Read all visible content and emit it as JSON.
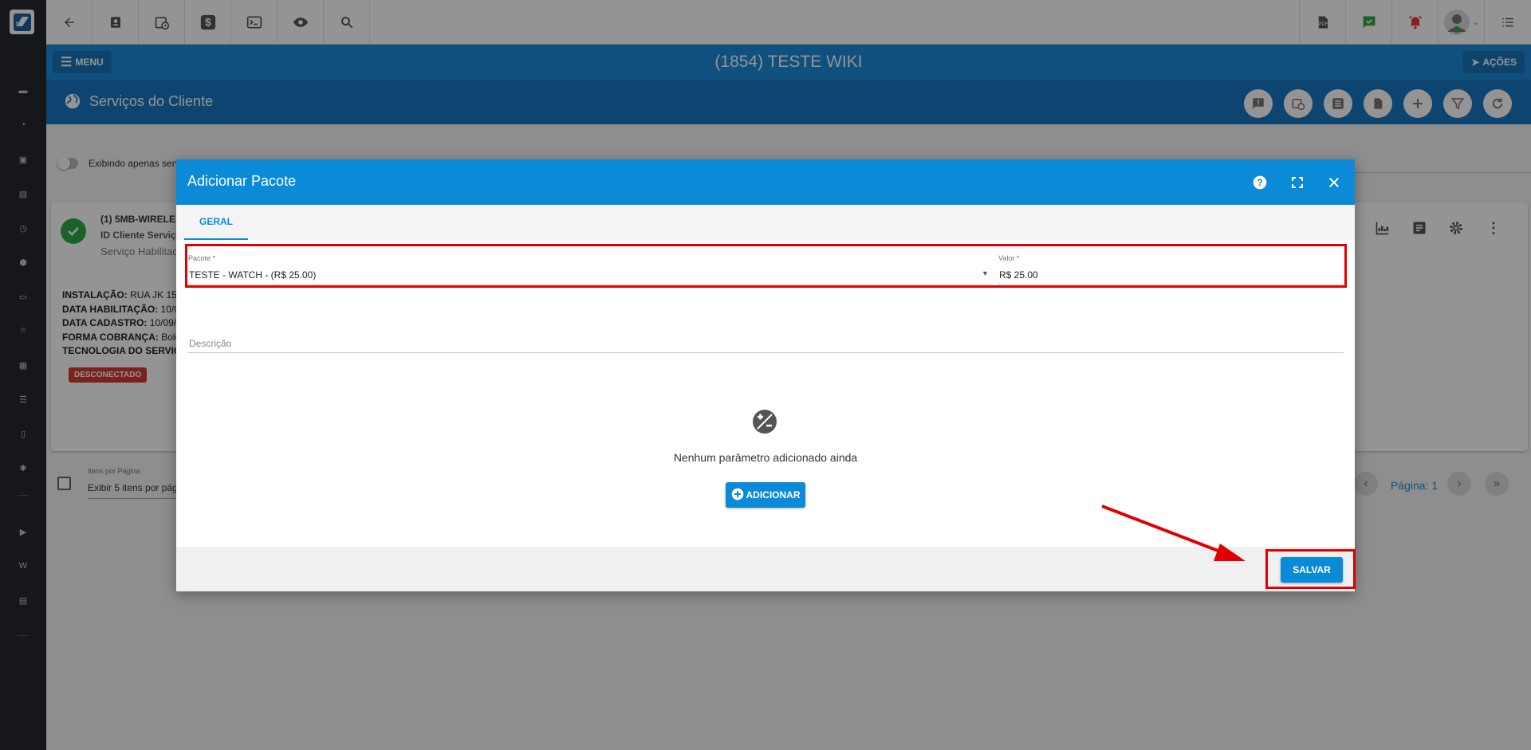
{
  "topbar": {
    "icons": [
      "back-icon",
      "contact-icon",
      "calendar-clock-icon",
      "dollar-icon",
      "terminal-icon",
      "eye-icon",
      "search-icon"
    ],
    "right_icons": [
      "pdf-icon",
      "chat-check-icon",
      "alarm-icon",
      "avatar",
      "list-icon"
    ]
  },
  "header": {
    "menu_label": "MENU",
    "title": "(1854) TESTE WIKI",
    "actions_label": "AÇÕES"
  },
  "subheader": {
    "title": "Serviços do Cliente"
  },
  "background": {
    "toggle_label": "Exibindo apenas serv",
    "service_name": "(1) 5MB-WIRELE",
    "service_id": "ID Cliente Serviç",
    "service_status": "Serviço Habilitad",
    "details": [
      {
        "label": "INSTALAÇÃO:",
        "value": "RUA JK 15"
      },
      {
        "label": "DATA HABILITAÇÃO:",
        "value": "10/0"
      },
      {
        "label": "DATA CADASTRO:",
        "value": "10/09/"
      },
      {
        "label": "FORMA COBRANÇA:",
        "value": "Bole"
      },
      {
        "label": "TECNOLOGIA DO SERVIÇ",
        "value": ""
      }
    ],
    "badge": "DESCONECTADO",
    "items_per_page_label": "Itens por Página",
    "items_per_page_value": "Exibir 5 itens por pági",
    "pagination": "Página: 1"
  },
  "modal": {
    "title": "Adicionar Pacote",
    "tab_general": "GERAL",
    "pacote_label": "Pacote *",
    "pacote_value": "TESTE - WATCH - (R$ 25.00)",
    "valor_label": "Valor *",
    "valor_value": "R$ 25.00",
    "descricao_placeholder": "Descrição",
    "empty_message": "Nenhum parâmetro adicionado ainda",
    "add_button": "ADICIONAR",
    "save_button": "SALVAR"
  },
  "colors": {
    "primary": "#0b8ad8",
    "header": "#1d8ad9",
    "subheader": "#1977c2",
    "sidebar": "#26292e",
    "highlight": "#e00000",
    "badge": "#d63b2f",
    "success": "#2eaa47"
  }
}
